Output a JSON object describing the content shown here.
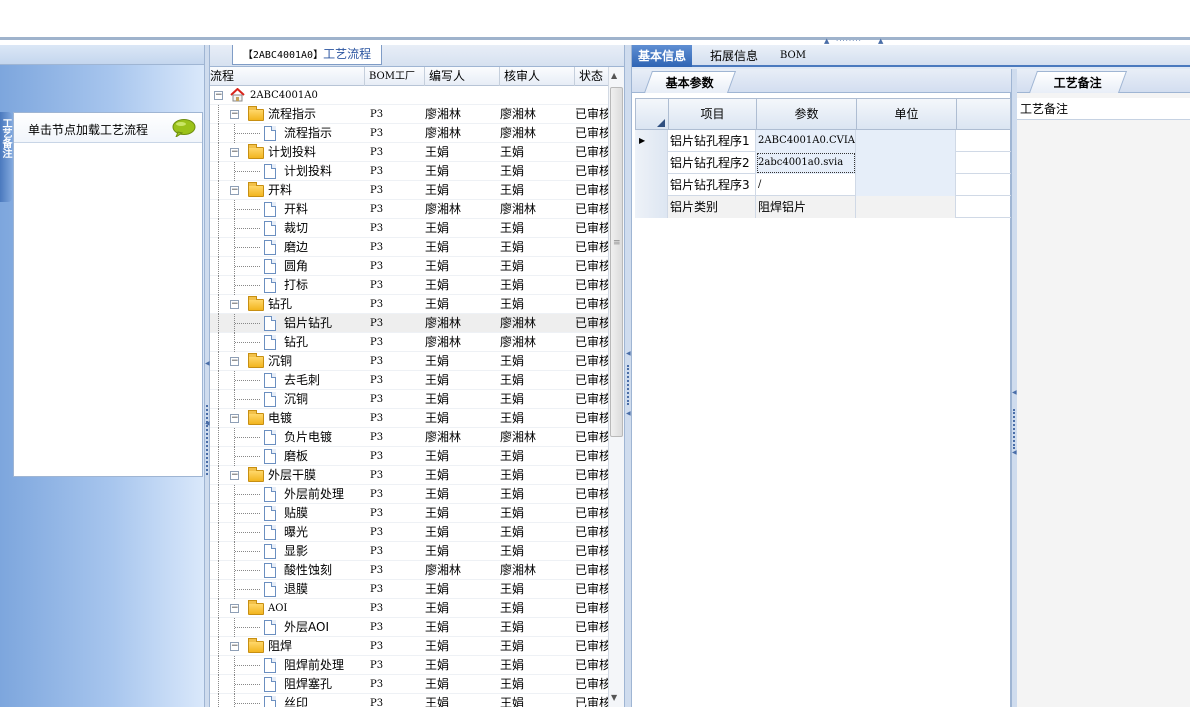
{
  "left_panel": {
    "vertical_tab": "工艺备注",
    "hint": "单击节点加载工艺流程"
  },
  "tree_panel": {
    "title_code": "【2ABC4001A0】",
    "title_text": "工艺流程",
    "columns": [
      "流程",
      "BOM工厂",
      "编写人",
      "核审人",
      "状态"
    ],
    "rows": [
      {
        "level": 0,
        "type": "root",
        "name": "2ABC4001A0",
        "bom": "",
        "writer": "",
        "reviewer": "",
        "status": ""
      },
      {
        "level": 1,
        "type": "folder",
        "name": "流程指示",
        "bom": "P3",
        "writer": "廖湘林",
        "reviewer": "廖湘林",
        "status": "已审核"
      },
      {
        "level": 2,
        "type": "doc",
        "name": "流程指示",
        "bom": "P3",
        "writer": "廖湘林",
        "reviewer": "廖湘林",
        "status": "已审核"
      },
      {
        "level": 1,
        "type": "folder",
        "name": "计划投料",
        "bom": "P3",
        "writer": "王娟",
        "reviewer": "王娟",
        "status": "已审核"
      },
      {
        "level": 2,
        "type": "doc",
        "name": "计划投料",
        "bom": "P3",
        "writer": "王娟",
        "reviewer": "王娟",
        "status": "已审核"
      },
      {
        "level": 1,
        "type": "folder",
        "name": "开料",
        "bom": "P3",
        "writer": "王娟",
        "reviewer": "王娟",
        "status": "已审核"
      },
      {
        "level": 2,
        "type": "doc",
        "name": "开料",
        "bom": "P3",
        "writer": "廖湘林",
        "reviewer": "廖湘林",
        "status": "已审核"
      },
      {
        "level": 2,
        "type": "doc",
        "name": "裁切",
        "bom": "P3",
        "writer": "王娟",
        "reviewer": "王娟",
        "status": "已审核"
      },
      {
        "level": 2,
        "type": "doc",
        "name": "磨边",
        "bom": "P3",
        "writer": "王娟",
        "reviewer": "王娟",
        "status": "已审核"
      },
      {
        "level": 2,
        "type": "doc",
        "name": "圆角",
        "bom": "P3",
        "writer": "王娟",
        "reviewer": "王娟",
        "status": "已审核"
      },
      {
        "level": 2,
        "type": "doc",
        "name": "打标",
        "bom": "P3",
        "writer": "王娟",
        "reviewer": "王娟",
        "status": "已审核"
      },
      {
        "level": 1,
        "type": "folder",
        "name": "钻孔",
        "bom": "P3",
        "writer": "王娟",
        "reviewer": "王娟",
        "status": "已审核"
      },
      {
        "level": 2,
        "type": "doc",
        "name": "铝片钻孔",
        "bom": "P3",
        "writer": "廖湘林",
        "reviewer": "廖湘林",
        "status": "已审核",
        "selected": true
      },
      {
        "level": 2,
        "type": "doc",
        "name": "钻孔",
        "bom": "P3",
        "writer": "廖湘林",
        "reviewer": "廖湘林",
        "status": "已审核"
      },
      {
        "level": 1,
        "type": "folder",
        "name": "沉铜",
        "bom": "P3",
        "writer": "王娟",
        "reviewer": "王娟",
        "status": "已审核"
      },
      {
        "level": 2,
        "type": "doc",
        "name": "去毛刺",
        "bom": "P3",
        "writer": "王娟",
        "reviewer": "王娟",
        "status": "已审核"
      },
      {
        "level": 2,
        "type": "doc",
        "name": "沉铜",
        "bom": "P3",
        "writer": "王娟",
        "reviewer": "王娟",
        "status": "已审核"
      },
      {
        "level": 1,
        "type": "folder",
        "name": "电镀",
        "bom": "P3",
        "writer": "王娟",
        "reviewer": "王娟",
        "status": "已审核"
      },
      {
        "level": 2,
        "type": "doc",
        "name": "负片电镀",
        "bom": "P3",
        "writer": "廖湘林",
        "reviewer": "廖湘林",
        "status": "已审核"
      },
      {
        "level": 2,
        "type": "doc",
        "name": "磨板",
        "bom": "P3",
        "writer": "王娟",
        "reviewer": "王娟",
        "status": "已审核"
      },
      {
        "level": 1,
        "type": "folder",
        "name": "外层干膜",
        "bom": "P3",
        "writer": "王娟",
        "reviewer": "王娟",
        "status": "已审核"
      },
      {
        "level": 2,
        "type": "doc",
        "name": "外层前处理",
        "bom": "P3",
        "writer": "王娟",
        "reviewer": "王娟",
        "status": "已审核"
      },
      {
        "level": 2,
        "type": "doc",
        "name": "贴膜",
        "bom": "P3",
        "writer": "王娟",
        "reviewer": "王娟",
        "status": "已审核"
      },
      {
        "level": 2,
        "type": "doc",
        "name": "曝光",
        "bom": "P3",
        "writer": "王娟",
        "reviewer": "王娟",
        "status": "已审核"
      },
      {
        "level": 2,
        "type": "doc",
        "name": "显影",
        "bom": "P3",
        "writer": "王娟",
        "reviewer": "王娟",
        "status": "已审核"
      },
      {
        "level": 2,
        "type": "doc",
        "name": "酸性蚀刻",
        "bom": "P3",
        "writer": "廖湘林",
        "reviewer": "廖湘林",
        "status": "已审核"
      },
      {
        "level": 2,
        "type": "doc",
        "name": "退膜",
        "bom": "P3",
        "writer": "王娟",
        "reviewer": "王娟",
        "status": "已审核"
      },
      {
        "level": 1,
        "type": "folder",
        "name": "AOI",
        "bom": "P3",
        "writer": "王娟",
        "reviewer": "王娟",
        "status": "已审核"
      },
      {
        "level": 2,
        "type": "doc",
        "name": "外层AOI",
        "bom": "P3",
        "writer": "王娟",
        "reviewer": "王娟",
        "status": "已审核"
      },
      {
        "level": 1,
        "type": "folder",
        "name": "阻焊",
        "bom": "P3",
        "writer": "王娟",
        "reviewer": "王娟",
        "status": "已审核"
      },
      {
        "level": 2,
        "type": "doc",
        "name": "阻焊前处理",
        "bom": "P3",
        "writer": "王娟",
        "reviewer": "王娟",
        "status": "已审核"
      },
      {
        "level": 2,
        "type": "doc",
        "name": "阻焊塞孔",
        "bom": "P3",
        "writer": "王娟",
        "reviewer": "王娟",
        "status": "已审核"
      },
      {
        "level": 2,
        "type": "doc",
        "name": "丝印",
        "bom": "P3",
        "writer": "王娟",
        "reviewer": "王娟",
        "status": "已审核"
      }
    ]
  },
  "right_panel": {
    "tabs": [
      "基本信息",
      "拓展信息",
      "BOM"
    ],
    "base_tab": "基本参数",
    "grid_columns": [
      "项目",
      "参数",
      "单位"
    ],
    "grid_rows": [
      {
        "item": "铝片钻孔程序1",
        "param": "2ABC4001A0.CVIA",
        "unit": ""
      },
      {
        "item": "铝片钻孔程序2",
        "param": "2abc4001a0.svia",
        "unit": ""
      },
      {
        "item": "铝片钻孔程序3",
        "param": "/",
        "unit": ""
      },
      {
        "item": "铝片类别",
        "param": "阻焊铝片",
        "unit": ""
      }
    ],
    "note_tab": "工艺备注",
    "note_header": "工艺备注"
  },
  "colors": {
    "accent": "#2e64b4",
    "panel_bg": "#dfe8f5",
    "left_gradient_start": "#7da6dd"
  }
}
